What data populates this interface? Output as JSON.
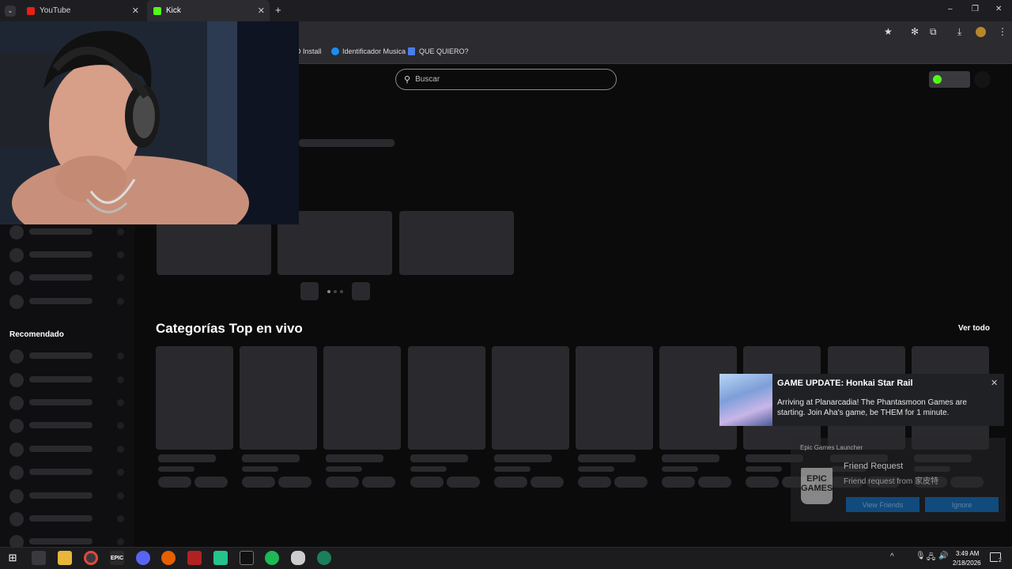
{
  "browser": {
    "tabs": [
      {
        "label": "YouTube",
        "active": false
      },
      {
        "label": "Kick",
        "active": true
      }
    ],
    "new_tab_symbol": "+",
    "bookmarks": [
      {
        "label": "D Install"
      },
      {
        "label": "Identificador Musica"
      },
      {
        "label": "QUE QUIERO?"
      }
    ],
    "window_controls": [
      "–",
      "❐",
      "✕"
    ]
  },
  "page": {
    "search_placeholder": "Buscar",
    "sidebar_recommended_label": "Recomendado",
    "section_title": "Categorías Top en vivo",
    "see_all": "Ver todo"
  },
  "notification": {
    "title": "GAME UPDATE: Honkai Star Rail",
    "body": "Arriving at Planarcadia! The Phantasmoon Games are starting. Join Aha's game, be THEM for 1 minute.",
    "close": "✕"
  },
  "epic_popup": {
    "source": "Epic Games Launcher",
    "logo_text": "EPIC GAMES",
    "title": "Friend Request",
    "body": "Friend request from 家皮特",
    "accept": "View Friends",
    "decline": "Ignore"
  },
  "taskbar": {
    "time": "3:49 AM",
    "date": "2/18/2026",
    "notification_count": "2"
  },
  "colors": {
    "kick_green": "#53fc18",
    "page_bg": "#0b0b0c",
    "skeleton": "#2a2a2e",
    "epic_button": "#0f5a9e"
  }
}
